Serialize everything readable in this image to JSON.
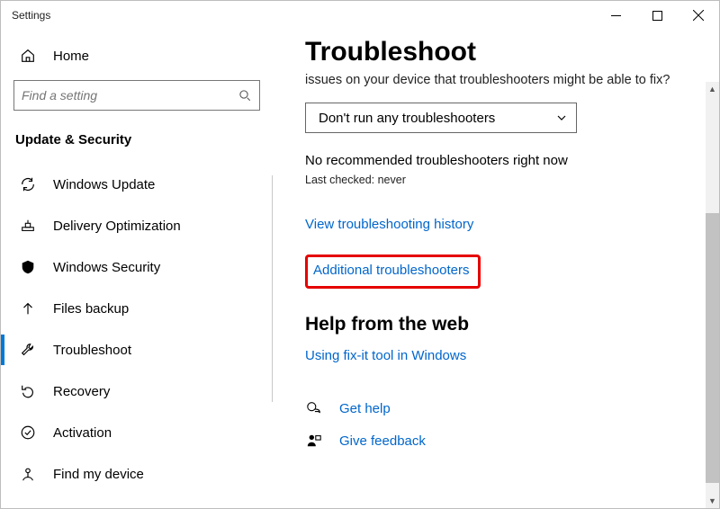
{
  "window": {
    "title": "Settings"
  },
  "sidebar": {
    "home": "Home",
    "search_placeholder": "Find a setting",
    "section": "Update & Security",
    "items": [
      {
        "label": "Windows Update"
      },
      {
        "label": "Delivery Optimization"
      },
      {
        "label": "Windows Security"
      },
      {
        "label": "Files backup"
      },
      {
        "label": "Troubleshoot"
      },
      {
        "label": "Recovery"
      },
      {
        "label": "Activation"
      },
      {
        "label": "Find my device"
      }
    ]
  },
  "main": {
    "title": "Troubleshoot",
    "truncated": "issues on your device that troubleshooters might be able to fix?",
    "dropdown_value": "Don't run any troubleshooters",
    "no_reco": "No recommended troubleshooters right now",
    "last_checked": "Last checked: never",
    "history_link": "View troubleshooting history",
    "additional_link": "Additional troubleshooters",
    "help_header": "Help from the web",
    "fixit_link": "Using fix-it tool in Windows",
    "get_help": "Get help",
    "give_feedback": "Give feedback"
  }
}
